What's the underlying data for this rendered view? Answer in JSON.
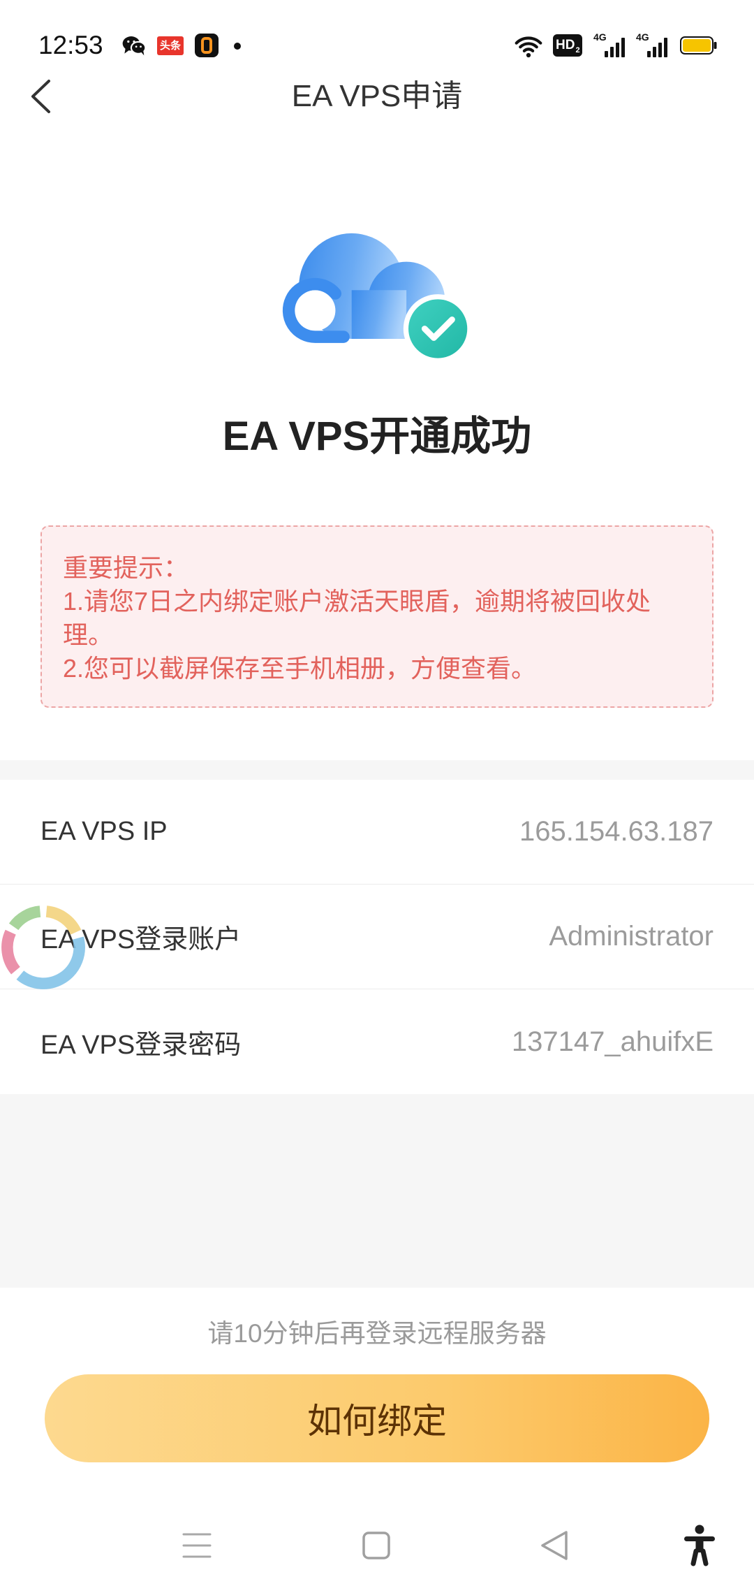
{
  "status_bar": {
    "time": "12:53",
    "notification_icons": [
      "wechat-icon",
      "toutiao-icon",
      "app-icon",
      "more-dot-icon"
    ],
    "toutiao_label": "头条",
    "hd_label": "HD",
    "hd_sim": "2",
    "sim1_network": "4G",
    "sim2_network": "4G",
    "status_icons": [
      "wifi-icon",
      "hd-voice-icon",
      "signal-icon",
      "signal-icon",
      "battery-icon"
    ],
    "battery_color": "#f6c400"
  },
  "nav": {
    "title": "EA VPS申请",
    "back_icon": "chevron-left-icon"
  },
  "hero": {
    "icon": "cloud-check-icon",
    "title": "EA VPS开通成功"
  },
  "notice": {
    "heading": "重要提示：",
    "items": [
      "1.请您7日之内绑定账户激活天眼盾，逾期将被回收处理。",
      "2.您可以截屏保存至手机相册，方便查看。"
    ]
  },
  "details": [
    {
      "label": "EA VPS IP",
      "value": "165.154.63.187"
    },
    {
      "label": "EA VPS登录账户",
      "value": "Administrator"
    },
    {
      "label": "EA VPS登录密码",
      "value": "137147_ahuifxE"
    }
  ],
  "floating_widget": {
    "icon": "loading-ring-icon"
  },
  "footer": {
    "hint": "请10分钟后再登录远程服务器",
    "button_label": "如何绑定"
  },
  "system_nav": {
    "icons": [
      "menu-icon",
      "home-icon",
      "back-triangle-icon",
      "accessibility-icon"
    ]
  },
  "colors": {
    "notice_text": "#e2625c",
    "notice_background": "#fdeff0",
    "notice_border": "#eca5a5",
    "button_gradient": [
      "#fdd98f",
      "#fbb446"
    ],
    "button_text": "#5c3205",
    "cloud_blue": "#3b8ced",
    "check_badge": "#2cc2b1",
    "value_text": "#9b9b9b",
    "section_gray": "#f6f6f6"
  }
}
